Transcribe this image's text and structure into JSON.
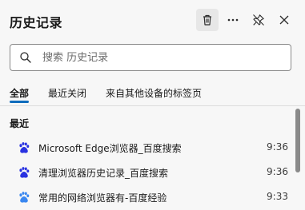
{
  "header": {
    "title": "历史记录"
  },
  "search": {
    "placeholder": "搜索 历史记录"
  },
  "tabs": [
    {
      "label": "全部"
    },
    {
      "label": "最近关闭"
    },
    {
      "label": "来自其他设备的标签页"
    }
  ],
  "section": {
    "title": "最近"
  },
  "items": [
    {
      "title": "Microsoft Edge浏览器_百度搜索",
      "time": "9:36",
      "icon": "baidu-paw-icon",
      "color": "#2932e1"
    },
    {
      "title": "清理浏览器历史记录_百度搜索",
      "time": "9:36",
      "icon": "baidu-paw-icon",
      "color": "#2932e1"
    },
    {
      "title": "常用的网络浏览器有-百度经验",
      "time": "9:33",
      "icon": "baidu-paw-icon",
      "color": "#3a87f0"
    }
  ],
  "colors": {
    "accent": "#0f6cbd"
  }
}
